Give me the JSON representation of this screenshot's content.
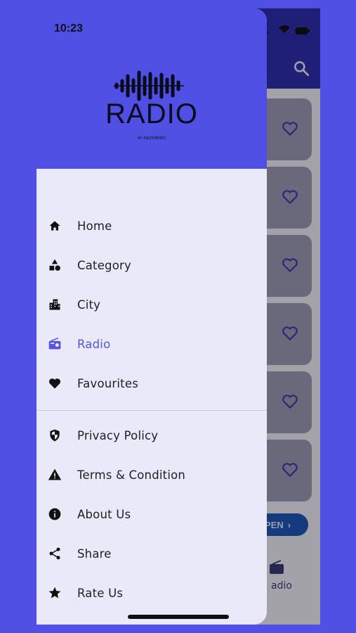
{
  "status_bar": {
    "time": "10:23"
  },
  "brand": {
    "logo_text": "RADIO",
    "logo_subtext": "BY ANGTHEMES"
  },
  "menu": {
    "primary": [
      {
        "label": "Home",
        "icon": "home-icon"
      },
      {
        "label": "Category",
        "icon": "category-icon"
      },
      {
        "label": "City",
        "icon": "city-icon"
      },
      {
        "label": "Radio",
        "icon": "radio-icon",
        "active": true
      },
      {
        "label": "Favourites",
        "icon": "heart-icon"
      }
    ],
    "secondary": [
      {
        "label": "Privacy Policy",
        "icon": "shield-icon"
      },
      {
        "label": "Terms & Condition",
        "icon": "warning-icon"
      },
      {
        "label": "About Us",
        "icon": "info-icon"
      },
      {
        "label": "Share",
        "icon": "share-icon"
      },
      {
        "label": "Rate Us",
        "icon": "star-icon"
      }
    ]
  },
  "background": {
    "open_button_label": "PEN",
    "bottom_tab_label": "adio"
  },
  "colors": {
    "accent": "#5656e0",
    "drawer_bg": "#e9e9f7",
    "header_bg": "#4f4fe3"
  }
}
